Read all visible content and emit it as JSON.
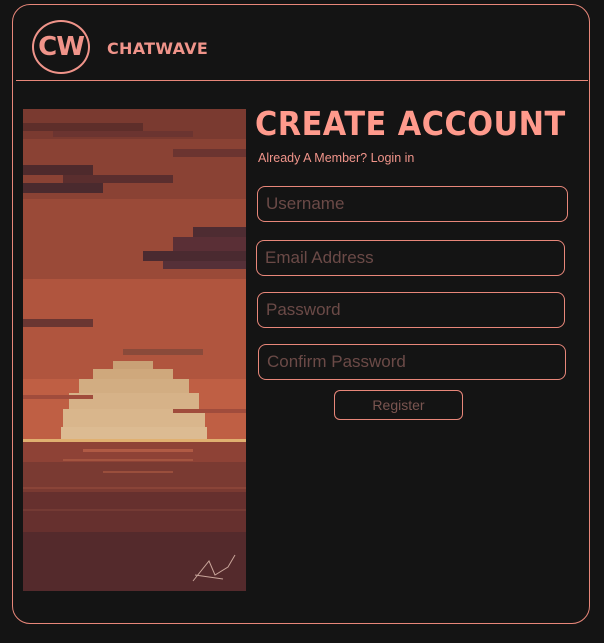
{
  "header": {
    "logo_text": "CW",
    "brand_name": "CHATWAVE"
  },
  "main": {
    "title": "CREATE ACCOUNT",
    "member_prompt": "Already A Member?",
    "login_link": "Login in",
    "fields": {
      "username_placeholder": "Username",
      "email_placeholder": "Email Address",
      "password_placeholder": "Password",
      "confirm_placeholder": "Confirm Password"
    },
    "register_label": "Register"
  },
  "art": {
    "description_icon": "pixel-sunset-image"
  },
  "colors": {
    "accent": "#f0948a",
    "background": "#141414"
  }
}
